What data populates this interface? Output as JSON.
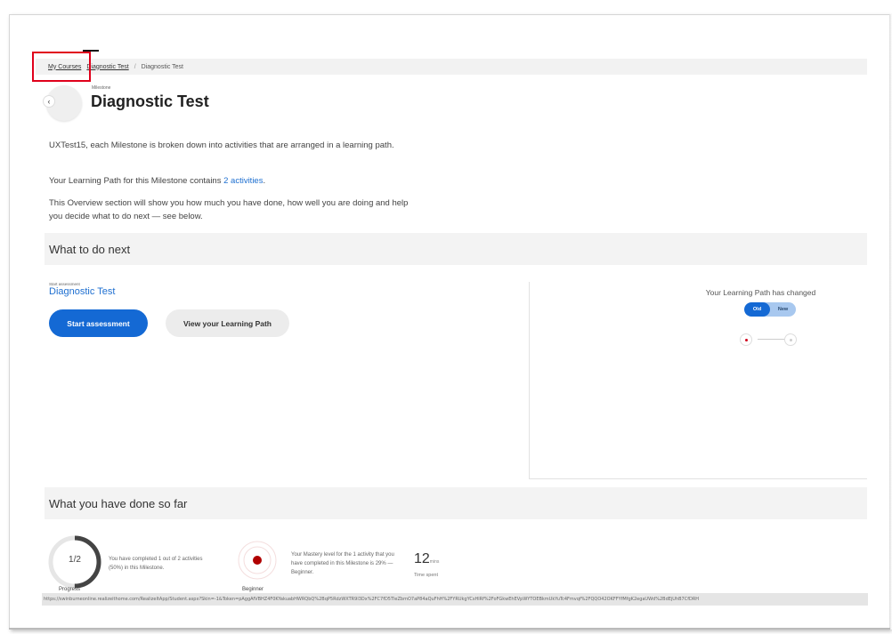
{
  "breadcrumb": {
    "items": [
      "My Courses",
      "Diagnostic Test",
      "Diagnostic Test"
    ],
    "separator": "/"
  },
  "header": {
    "back_icon": "chevron-left-icon",
    "back_glyph": "‹",
    "eyebrow": "Milestone",
    "title": "Diagnostic Test"
  },
  "intro": {
    "p1": "UXTest15, each Milestone is broken down into activities that are arranged in a learning path.",
    "p2_prefix": "Your Learning Path for this Milestone contains ",
    "p2_link": "2 activities",
    "p2_suffix": ".",
    "p3": "This Overview section will show you how much you have done, how well you are doing and help you decide what to do next — see below."
  },
  "next": {
    "heading": "What to do next",
    "eyebrow": "Start assessment",
    "activity_title": "Diagnostic Test",
    "start_button": "Start assessment",
    "path_button": "View your Learning Path"
  },
  "learning_path": {
    "title": "Your Learning Path has changed",
    "toggle": [
      "Old",
      "New"
    ],
    "selected": "Old",
    "node_colors": [
      "#d0021b",
      "#cccccc"
    ]
  },
  "done": {
    "heading": "What you have done so far",
    "progress_value": "1/2",
    "progress_fraction": 0.5,
    "progress_label": "Progress",
    "progress_text": "You have completed 1 out of 2 activities (50%) in this Milestone.",
    "mastery_text": "Your Mastery level for the 1 activity that you have completed in this Milestone is 29% — Beginner.",
    "mastery_label": "Beginner",
    "mastery_color": "#b00000",
    "time_value": "12",
    "time_unit": "mins",
    "time_label": "Time spent"
  },
  "status_url": "https://swinburneonline.realizeithome.com/RealizeItApp/Student.aspx?Skin=-1&Token=pAggAfVBHZ4F0KYakuabHWRQbQ%2BqP5RdzWXTR9l3Dx%2FC7fD5TleZbmO7aP84aQuFhH%2FYRUkgYCsHlRf%2FoFGkwEhEVpWYTOEBkmUkYuTc4Fmvqf%2FQQO42OKFFYfMfgK2egaUWd%2BdEjUhB7CfDRH"
}
